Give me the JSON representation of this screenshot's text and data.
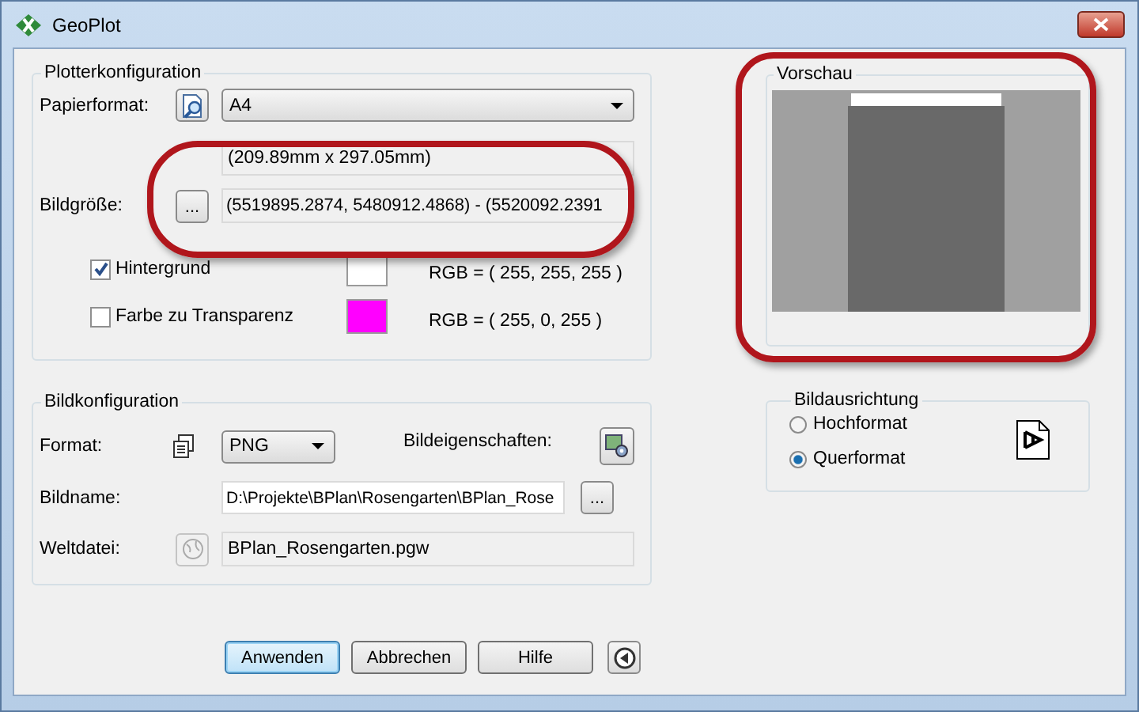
{
  "window": {
    "title": "GeoPlot"
  },
  "plotter": {
    "title": "Plotterkonfiguration",
    "paper_label": "Papierformat:",
    "paper_value": "A4",
    "size_mm": "(209.89mm x 297.05mm)",
    "size_label": "Bildgröße:",
    "browse": "...",
    "coords": "(5519895.2874, 5480912.4868) - (5520092.2391",
    "options": [
      {
        "label": "Hintergrund",
        "checked": true,
        "color": "#ffffff",
        "rgb": "RGB = ( 255, 255, 255 )"
      },
      {
        "label": "Farbe zu Transparenz",
        "checked": false,
        "color": "#ff00ff",
        "rgb": "RGB = ( 255, 0, 255 )"
      }
    ]
  },
  "image": {
    "title": "Bildkonfiguration",
    "format_label": "Format:",
    "format_value": "PNG",
    "props_label": "Bildeigenschaften:",
    "name_label": "Bildname:",
    "name_value": "D:\\Projekte\\BPlan\\Rosengarten\\BPlan_Rose",
    "name_browse": "...",
    "world_label": "Weltdatei:",
    "world_value": "BPlan_Rosengarten.pgw"
  },
  "buttons": [
    {
      "label": "Anwenden",
      "focused": true
    },
    {
      "label": "Abbrechen",
      "focused": false
    },
    {
      "label": "Hilfe",
      "focused": false
    }
  ],
  "preview": {
    "title": "Vorschau"
  },
  "orientation": {
    "title": "Bildausrichtung",
    "options": [
      {
        "label": "Hochformat",
        "selected": false
      },
      {
        "label": "Querformat",
        "selected": true
      }
    ]
  }
}
